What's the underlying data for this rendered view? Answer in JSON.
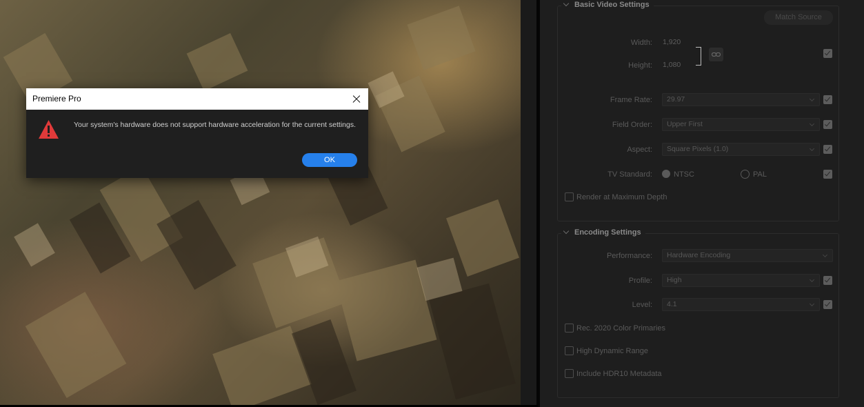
{
  "dialog": {
    "title": "Premiere Pro",
    "icon": "warning-icon",
    "message": "Your system's hardware does not support hardware acceleration for the current settings.",
    "ok_label": "OK",
    "accent": "#2680eb",
    "warning_color": "#e03a3a"
  },
  "basic_video": {
    "header": "Basic Video Settings",
    "match_source_label": "Match Source",
    "width_label": "Width:",
    "width_value": "1,920",
    "height_label": "Height:",
    "height_value": "1,080",
    "frame_rate_label": "Frame Rate:",
    "frame_rate_value": "29.97",
    "field_order_label": "Field Order:",
    "field_order_value": "Upper First",
    "aspect_label": "Aspect:",
    "aspect_value": "Square Pixels (1.0)",
    "tv_standard_label": "TV Standard:",
    "tv_ntsc_label": "NTSC",
    "tv_pal_label": "PAL",
    "tv_selected": "NTSC",
    "render_max_depth_label": "Render at Maximum Depth",
    "render_max_depth_checked": false
  },
  "encoding": {
    "header": "Encoding Settings",
    "performance_label": "Performance:",
    "performance_value": "Hardware Encoding",
    "profile_label": "Profile:",
    "profile_value": "High",
    "level_label": "Level:",
    "level_value": "4.1",
    "rec2020_label": "Rec. 2020 Color Primaries",
    "hdr_label": "High Dynamic Range",
    "hdr10_label": "Include HDR10 Metadata"
  }
}
